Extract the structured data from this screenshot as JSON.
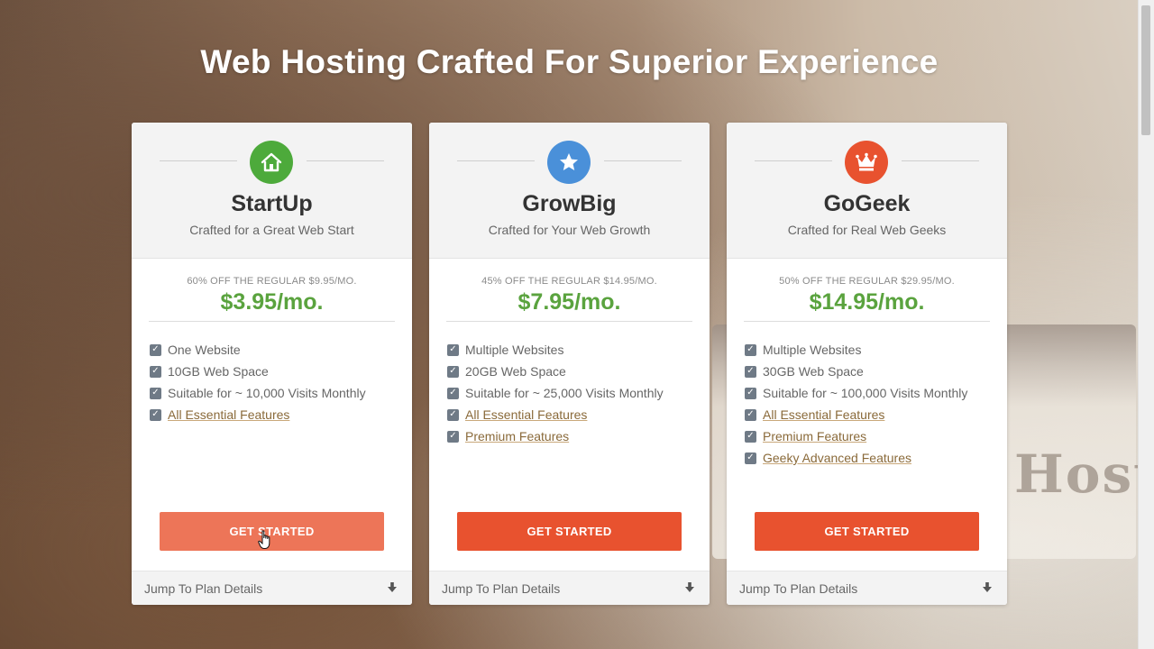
{
  "headline": "Web Hosting Crafted For Superior Experience",
  "background_text": "Host",
  "colors": {
    "price": "#5aa33e",
    "cta": "#e8522f",
    "cta_hover": "#ed7558",
    "icon_startup": "#4daa3b",
    "icon_growbig": "#4a90d9",
    "icon_gogeek": "#e8522f"
  },
  "plans": [
    {
      "icon": "house-icon",
      "name": "StartUp",
      "tagline": "Crafted for a Great Web Start",
      "discount": "60% OFF THE REGULAR $9.95/MO.",
      "price": "$3.95/mo.",
      "features": [
        {
          "text": "One Website"
        },
        {
          "text": "10GB Web Space"
        },
        {
          "text": "Suitable for ~ 10,000 Visits Monthly"
        },
        {
          "text": "All Essential Features",
          "link": true
        }
      ],
      "cta": "GET STARTED",
      "details": "Jump To Plan Details"
    },
    {
      "icon": "star-icon",
      "name": "GrowBig",
      "tagline": "Crafted for Your Web Growth",
      "discount": "45% OFF THE REGULAR $14.95/MO.",
      "price": "$7.95/mo.",
      "features": [
        {
          "text": "Multiple Websites"
        },
        {
          "text": "20GB Web Space"
        },
        {
          "text": "Suitable for ~ 25,000 Visits Monthly"
        },
        {
          "text": "All Essential Features",
          "link": true
        },
        {
          "text": "Premium Features",
          "link": true
        }
      ],
      "cta": "GET STARTED",
      "details": "Jump To Plan Details"
    },
    {
      "icon": "crown-icon",
      "name": "GoGeek",
      "tagline": "Crafted for Real Web Geeks",
      "discount": "50% OFF THE REGULAR $29.95/MO.",
      "price": "$14.95/mo.",
      "features": [
        {
          "text": "Multiple Websites"
        },
        {
          "text": "30GB Web Space"
        },
        {
          "text": "Suitable for ~ 100,000 Visits Monthly"
        },
        {
          "text": "All Essential Features",
          "link": true
        },
        {
          "text": "Premium Features",
          "link": true
        },
        {
          "text": "Geeky Advanced Features",
          "link": true
        }
      ],
      "cta": "GET STARTED",
      "details": "Jump To Plan Details"
    }
  ]
}
